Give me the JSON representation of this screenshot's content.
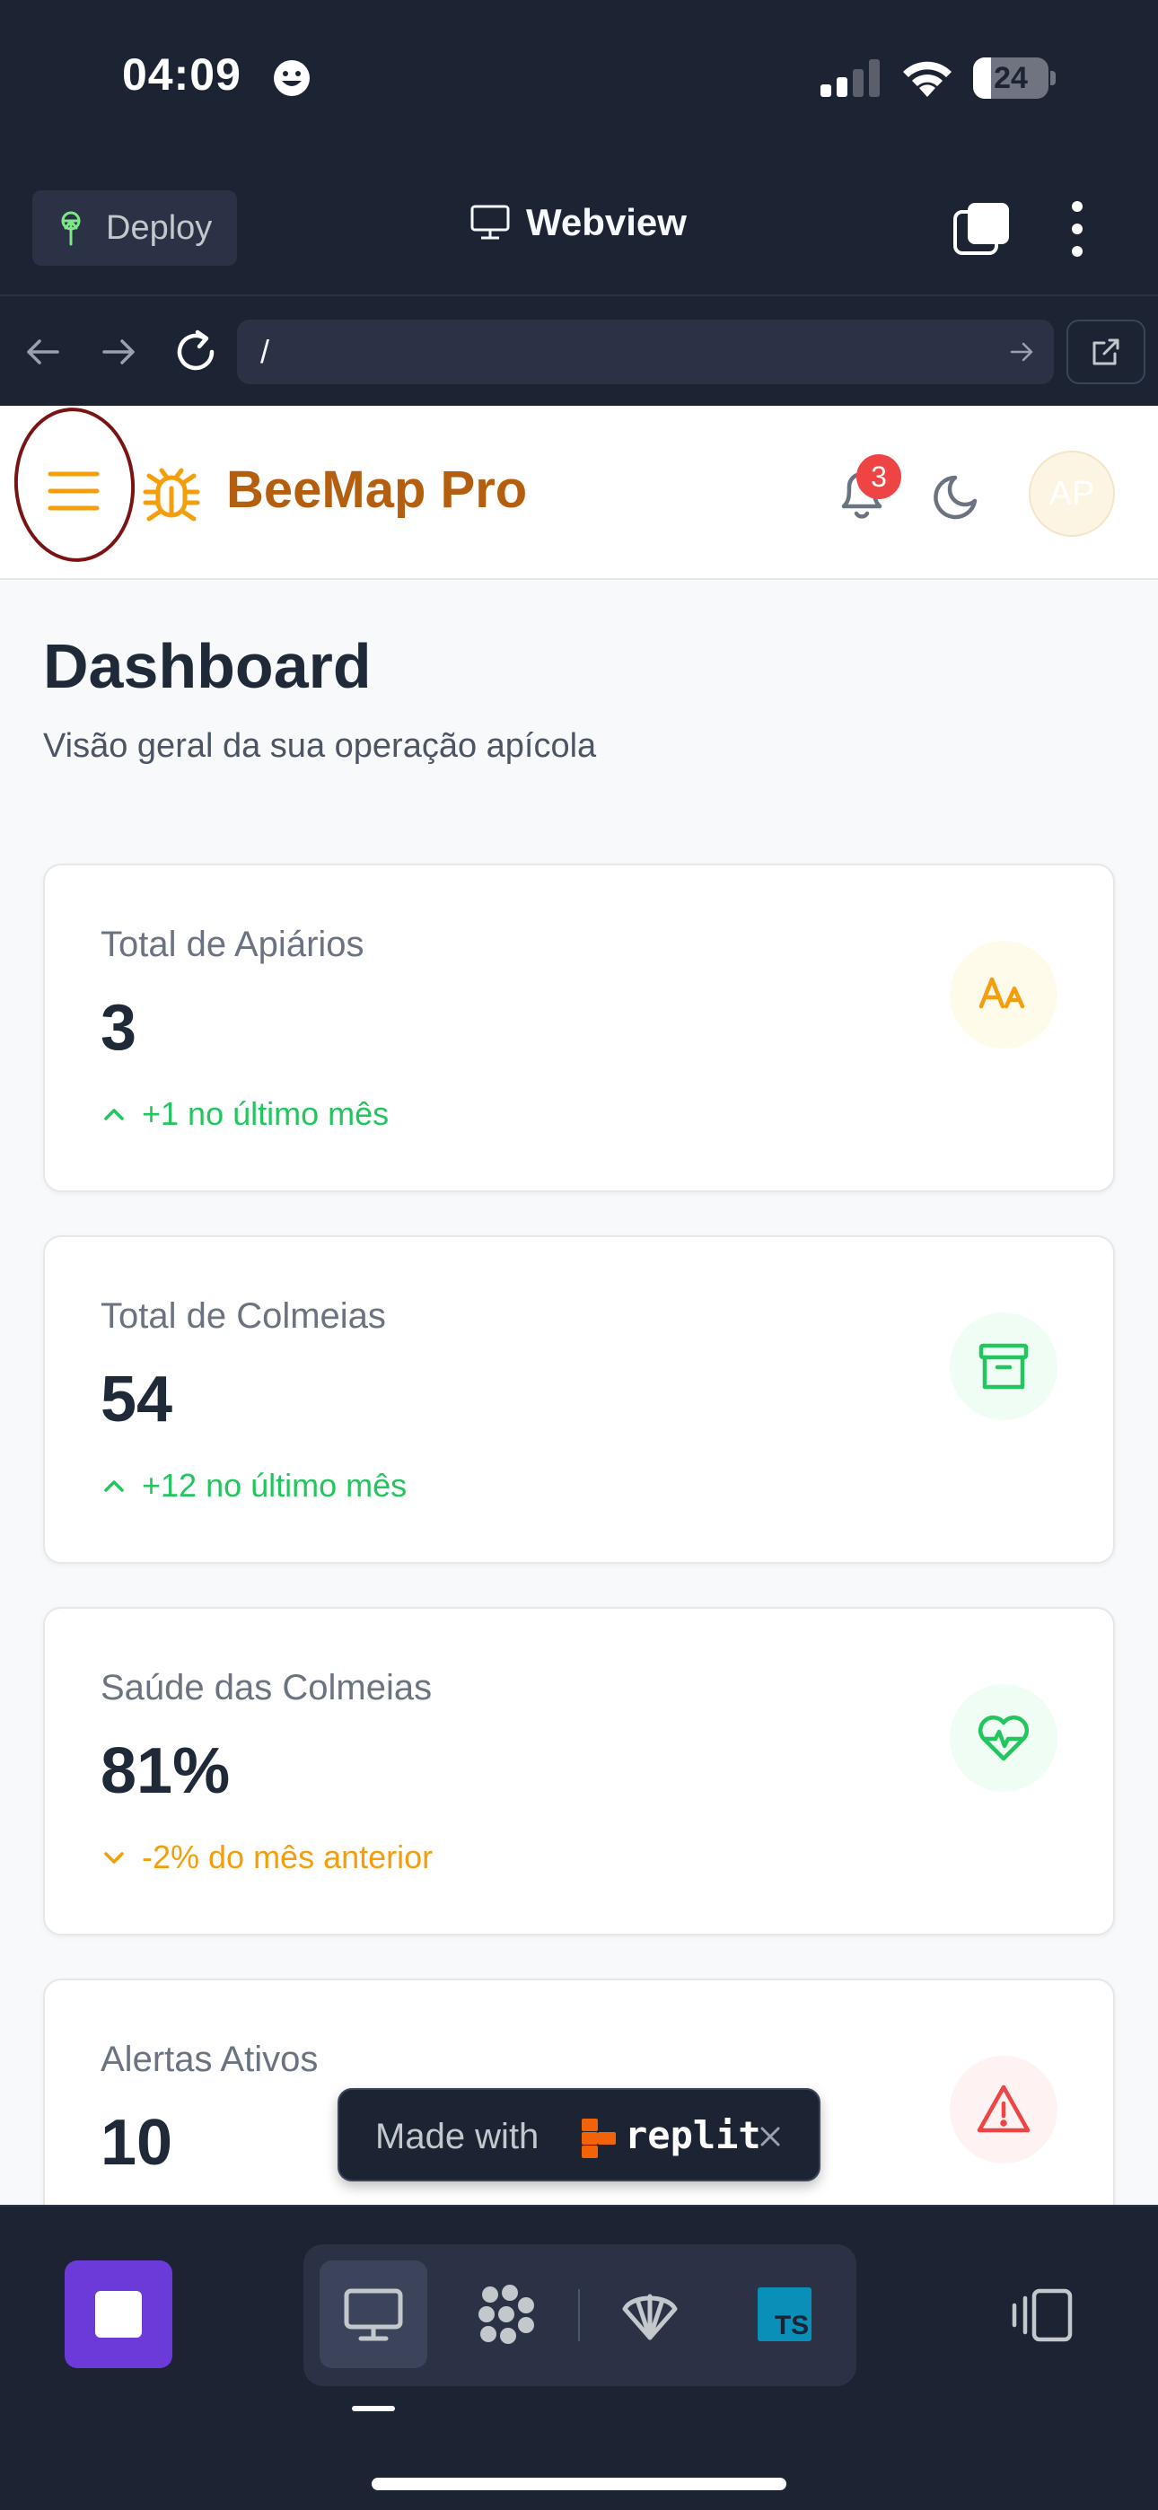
{
  "status_bar": {
    "time": "04:09",
    "battery_level": "24",
    "battery_fraction": 0.24
  },
  "replit": {
    "deploy_label": "Deploy",
    "view_title": "Webview",
    "url": "/",
    "made_with_text": "Made with",
    "made_with_brand": "replit"
  },
  "app": {
    "brand": "BeeMap Pro",
    "notification_count": "3",
    "avatar_initials": "AP",
    "accent_color": "#f59e0b",
    "brand_color": "#b45f0f"
  },
  "dashboard": {
    "title": "Dashboard",
    "subtitle": "Visão geral da sua operação apícola",
    "cards": [
      {
        "label": "Total de Apiários",
        "value": "3",
        "trend": "+1 no último mês",
        "trend_direction": "up",
        "trend_color": "#22c55e",
        "icon": "text-aa-icon",
        "icon_color": "#f59e0b",
        "icon_bg": "#fffbeb"
      },
      {
        "label": "Total de Colmeias",
        "value": "54",
        "trend": "+12 no último mês",
        "trend_direction": "up",
        "trend_color": "#22c55e",
        "icon": "archive-box-icon",
        "icon_color": "#22c55e",
        "icon_bg": "#f0fdf4"
      },
      {
        "label": "Saúde das Colmeias",
        "value": "81%",
        "trend": "-2% do mês anterior",
        "trend_direction": "down",
        "trend_color": "#f59e0b",
        "icon": "heart-pulse-icon",
        "icon_color": "#22c55e",
        "icon_bg": "#f0fdf4"
      },
      {
        "label": "Alertas Ativos",
        "value": "10",
        "trend": "",
        "trend_direction": "",
        "trend_color": "#ef4444",
        "icon": "alert-triangle-icon",
        "icon_color": "#ef4444",
        "icon_bg": "#fef2f2"
      }
    ]
  }
}
